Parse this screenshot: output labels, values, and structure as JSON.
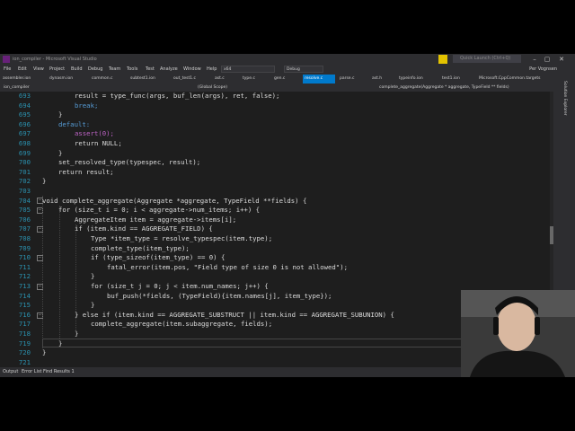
{
  "title_bar": {
    "title": "ion_compiler - Microsoft Visual Studio",
    "quick_launch": "Quick Launch (Ctrl+Q)"
  },
  "menu": {
    "items": [
      "File",
      "Edit",
      "View",
      "Project",
      "Build",
      "Debug",
      "Team",
      "Tools",
      "Test",
      "Analyze",
      "Window",
      "Help"
    ],
    "platform": "x64",
    "config": "Debug",
    "user": "Per Vognsen"
  },
  "tabs": [
    {
      "label": "assembler.ion"
    },
    {
      "label": "dynasm.ion"
    },
    {
      "label": "common.c"
    },
    {
      "label": "subtest1.ion"
    },
    {
      "label": "out_test1.c"
    },
    {
      "label": "ast.c"
    },
    {
      "label": "type.c"
    },
    {
      "label": "gen.c"
    },
    {
      "label": "resolve.c"
    },
    {
      "label": "parse.c"
    },
    {
      "label": "ast.h"
    },
    {
      "label": "typeinfo.ion"
    },
    {
      "label": "test1.ion"
    },
    {
      "label": "Microsoft.CppCommon.targets"
    }
  ],
  "nav": {
    "project": "ion_compiler",
    "scope": "(Global Scope)",
    "function": "complete_aggregate(Aggregate * aggregate, TypeField ** fields)"
  },
  "side_panel": {
    "label": "Solution Explorer"
  },
  "bottom_tabs": [
    "Output",
    "Error List",
    "Find Results 1"
  ],
  "line_numbers": [
    "693",
    "694",
    "695",
    "696",
    "697",
    "698",
    "699",
    "700",
    "701",
    "702",
    "703",
    "704",
    "705",
    "706",
    "707",
    "708",
    "709",
    "710",
    "711",
    "712",
    "713",
    "714",
    "715",
    "716",
    "717",
    "718",
    "719",
    "720",
    "721"
  ],
  "code": {
    "l693": "result = type_func(args, buf_len(args), ret, false);",
    "l694": "break;",
    "l695": "}",
    "l696": "default:",
    "l697": "assert(0);",
    "l698": "return NULL;",
    "l699": "}",
    "l700": "set_resolved_type(typespec, result);",
    "l701": "return result;",
    "l702": "}",
    "l704": "void complete_aggregate(Aggregate *aggregate, TypeField **fields) {",
    "l705": "for (size_t i = 0; i < aggregate->num_items; i++) {",
    "l706": "AggregateItem item = aggregate->items[i];",
    "l707": "if (item.kind == AGGREGATE_FIELD) {",
    "l708": "Type *item_type = resolve_typespec(item.type);",
    "l709": "complete_type(item_type);",
    "l710": "if (type_sizeof(item_type) == 0) {",
    "l711": "fatal_error(item.pos, \"Field type of size 0 is not allowed\");",
    "l712": "}",
    "l713": "for (size_t j = 0; j < item.num_names; j++) {",
    "l714": "buf_push(*fields, (TypeField){item.names[j], item_type});",
    "l715": "}",
    "l716": "} else if (item.kind == AGGREGATE_SUBSTRUCT || item.kind == AGGREGATE_SUBUNION) {",
    "l717": "complete_aggregate(item.subaggregate, fields);",
    "l718": "}",
    "l719": "}",
    "l720": "}"
  },
  "colors": {
    "accent": "#007acc",
    "editor_bg": "#1e1e1e",
    "keyword": "#569cd6",
    "type": "#4ec9b0",
    "string": "#d69d85",
    "number": "#b5cea8",
    "macro": "#bd63c5",
    "line_number": "#2b91af"
  }
}
